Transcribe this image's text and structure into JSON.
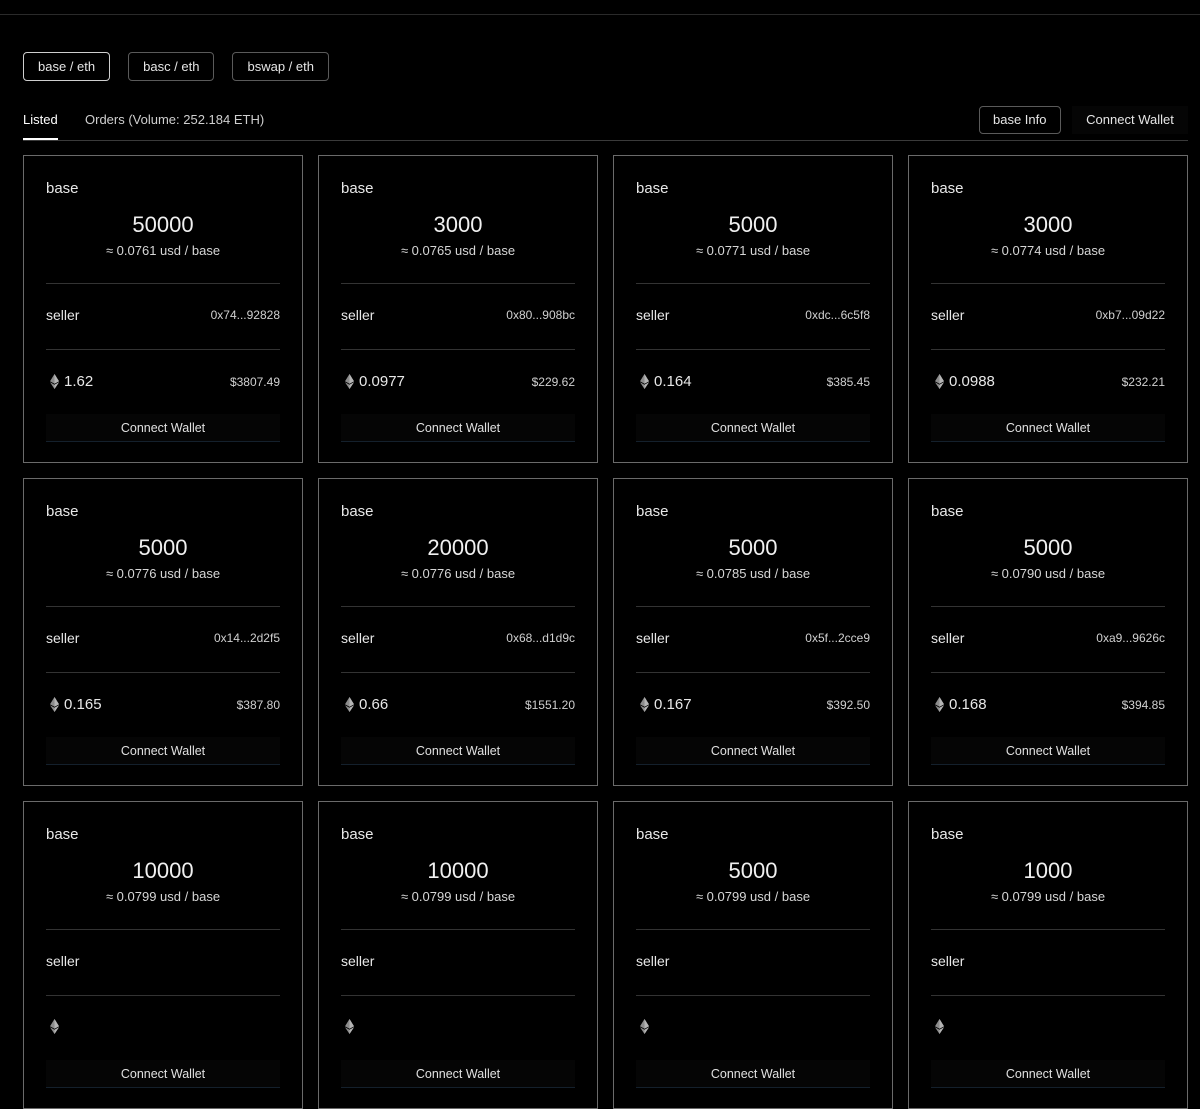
{
  "pairs": [
    "base / eth",
    "basc / eth",
    "bswap / eth"
  ],
  "tabs": {
    "listed": "Listed",
    "orders": "Orders (Volume: 252.184 ETH)"
  },
  "header": {
    "info_button": "base Info",
    "connect_wallet": "Connect Wallet"
  },
  "labels": {
    "seller": "seller",
    "connect": "Connect Wallet"
  },
  "cards": [
    {
      "token": "base",
      "amount": "50000",
      "price": "≈ 0.0761 usd / base",
      "seller_addr": "0x74...92828",
      "eth": "1.62",
      "usd": "$3807.49"
    },
    {
      "token": "base",
      "amount": "3000",
      "price": "≈ 0.0765 usd / base",
      "seller_addr": "0x80...908bc",
      "eth": "0.0977",
      "usd": "$229.62"
    },
    {
      "token": "base",
      "amount": "5000",
      "price": "≈ 0.0771 usd / base",
      "seller_addr": "0xdc...6c5f8",
      "eth": "0.164",
      "usd": "$385.45"
    },
    {
      "token": "base",
      "amount": "3000",
      "price": "≈ 0.0774 usd / base",
      "seller_addr": "0xb7...09d22",
      "eth": "0.0988",
      "usd": "$232.21"
    },
    {
      "token": "base",
      "amount": "5000",
      "price": "≈ 0.0776 usd / base",
      "seller_addr": "0x14...2d2f5",
      "eth": "0.165",
      "usd": "$387.80"
    },
    {
      "token": "base",
      "amount": "20000",
      "price": "≈ 0.0776 usd / base",
      "seller_addr": "0x68...d1d9c",
      "eth": "0.66",
      "usd": "$1551.20"
    },
    {
      "token": "base",
      "amount": "5000",
      "price": "≈ 0.0785 usd / base",
      "seller_addr": "0x5f...2cce9",
      "eth": "0.167",
      "usd": "$392.50"
    },
    {
      "token": "base",
      "amount": "5000",
      "price": "≈ 0.0790 usd / base",
      "seller_addr": "0xa9...9626c",
      "eth": "0.168",
      "usd": "$394.85"
    },
    {
      "token": "base",
      "amount": "10000",
      "price": "≈ 0.0799 usd / base",
      "seller_addr": "",
      "eth": "",
      "usd": ""
    },
    {
      "token": "base",
      "amount": "10000",
      "price": "≈ 0.0799 usd / base",
      "seller_addr": "",
      "eth": "",
      "usd": ""
    },
    {
      "token": "base",
      "amount": "5000",
      "price": "≈ 0.0799 usd / base",
      "seller_addr": "",
      "eth": "",
      "usd": ""
    },
    {
      "token": "base",
      "amount": "1000",
      "price": "≈ 0.0799 usd / base",
      "seller_addr": "",
      "eth": "",
      "usd": ""
    }
  ],
  "icons": {
    "eth": "ethereum-icon"
  },
  "colors": {
    "background": "#000000",
    "border": "#6a6a6a",
    "text": "#e6e6e6"
  }
}
